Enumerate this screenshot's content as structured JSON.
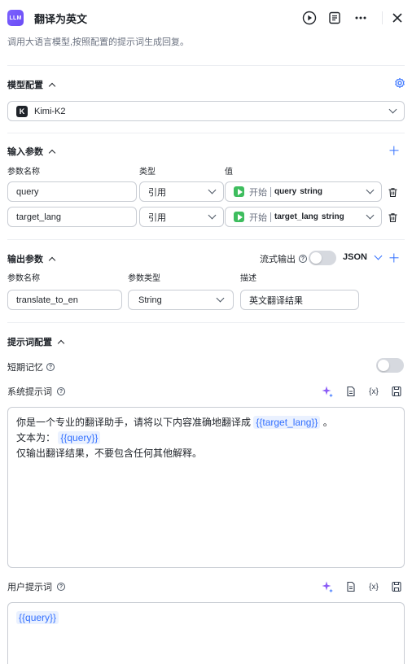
{
  "header": {
    "badge": "LLM",
    "title": "翻译为英文",
    "description": "调用大语言模型,按照配置的提示词生成回复。",
    "icons": [
      "play-icon",
      "notes-icon",
      "more-icon",
      "close-icon"
    ]
  },
  "model": {
    "section_title": "模型配置",
    "selected_model": "Kimi-K2",
    "model_logo": "K"
  },
  "inputs": {
    "section_title": "输入参数",
    "col_name": "参数名称",
    "col_type": "类型",
    "col_value": "值",
    "rows": [
      {
        "name": "query",
        "type": "引用",
        "ref_source": "开始",
        "ref_var": "query",
        "ref_type": "string"
      },
      {
        "name": "target_lang",
        "type": "引用",
        "ref_source": "开始",
        "ref_var": "target_lang",
        "ref_type": "string"
      }
    ]
  },
  "outputs": {
    "section_title": "输出参数",
    "stream_label": "流式输出",
    "format": "JSON",
    "col_name": "参数名称",
    "col_type": "参数类型",
    "col_desc": "描述",
    "row": {
      "name": "translate_to_en",
      "type": "String",
      "desc": "英文翻译结果"
    }
  },
  "prompt": {
    "section_title": "提示词配置",
    "memory_label": "短期记忆",
    "system_label": "系统提示词",
    "system_line1_prefix": "你是一个专业的翻译助手，请将以下内容准确地翻译成",
    "system_line1_var": "{{target_lang}}",
    "system_line1_suffix": "。",
    "system_line2_prefix": "文本为：",
    "system_line2_var": "{{query}}",
    "system_line3": "仅输出翻译结果，不要包含任何其他解释。",
    "user_label": "用户提示词",
    "user_var": "{{query}}",
    "var_button": "{x}"
  },
  "colors": {
    "accent": "#3370ff",
    "badge": "#7b61ff",
    "start_green": "#3ebd5e"
  }
}
